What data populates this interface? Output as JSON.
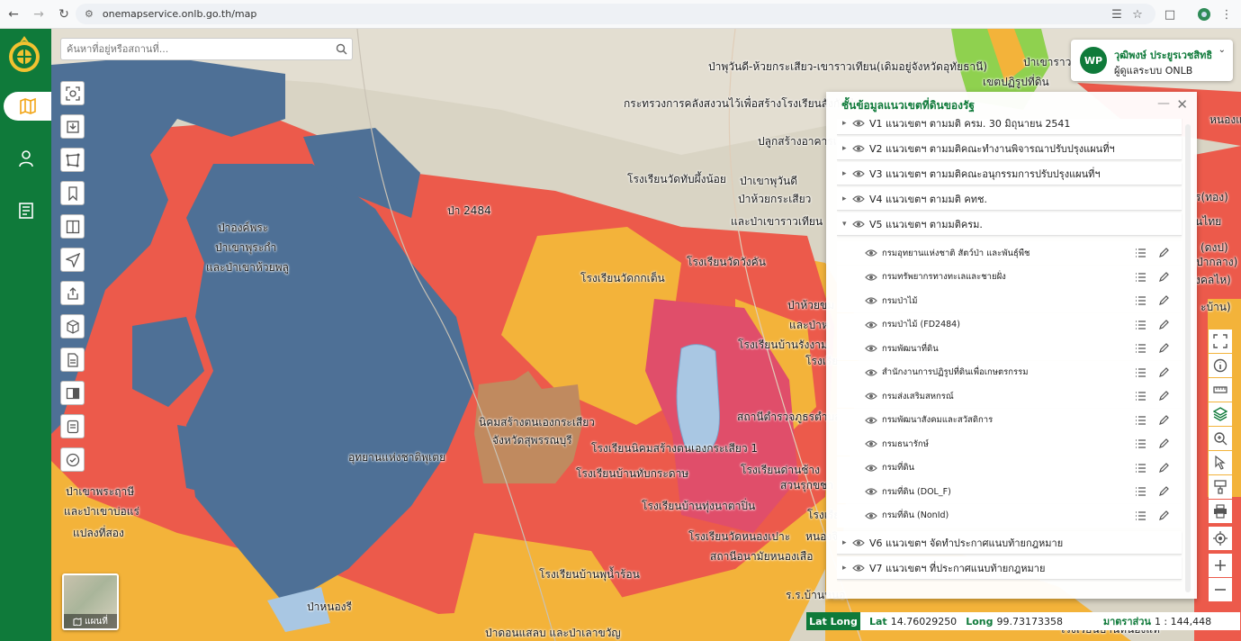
{
  "browser": {
    "url": "onemapservice.onlb.go.th/map"
  },
  "search": {
    "placeholder": "ค้นหาที่อยู่หรือสถานที่..."
  },
  "basemap": {
    "label": "แผนที่"
  },
  "user": {
    "initials": "WP",
    "name": "วุฒิพงษ์ ประยูรเวชสิทธิ",
    "role": "ผู้ดูแลระบบ ONLB"
  },
  "layer_panel": {
    "title": "ชั้นข้อมูลแนวเขตที่ดินของรัฐ",
    "groups": [
      {
        "label": "V1 แนวเขตฯ ตามมติ ครม. 30 มิถุนายน 2541",
        "expanded": false
      },
      {
        "label": "V2 แนวเขตฯ ตามมติคณะทำงานพิจารณาปรับปรุงแผนที่ฯ",
        "expanded": false
      },
      {
        "label": "V3 แนวเขตฯ ตามมติคณะอนุกรรมการปรับปรุงแผนที่ฯ",
        "expanded": false
      },
      {
        "label": "V4 แนวเขตฯ ตามมติ คทช.",
        "expanded": false
      },
      {
        "label": "V5 แนวเขตฯ ตามมติครม.",
        "expanded": true
      },
      {
        "label": "V6 แนวเขตฯ จัดทำประกาศแนบท้ายกฎหมาย",
        "expanded": false
      },
      {
        "label": "V7 แนวเขตฯ ที่ประกาศแนบท้ายกฎหมาย",
        "expanded": false
      }
    ],
    "v5_layers": [
      "กรมอุทยานแห่งชาติ สัตว์ป่า และพันธุ์พืช",
      "กรมทรัพยากรทางทะเลและชายฝั่ง",
      "กรมป่าไม้",
      "กรมป่าไม้ (FD2484)",
      "กรมพัฒนาที่ดิน",
      "สำนักงานการปฏิรูปที่ดินเพื่อเกษตรกรรม",
      "กรมส่งเสริมสหกรณ์",
      "กรมพัฒนาสังคมและสวัสดิการ",
      "กรมธนารักษ์",
      "กรมที่ดิน",
      "กรมที่ดิน (DOL_F)",
      "กรมที่ดิน (NonId)"
    ]
  },
  "coords": {
    "mode": "Lat Long",
    "lat_label": "Lat",
    "lat": "14.76029250",
    "long_label": "Long",
    "long": "99.73173358",
    "scale_label": "มาตราส่วน",
    "scale": "1 : 144,448"
  },
  "map_labels": [
    "ป่าเขาราวเทียน",
    "ป่าพุวันดี-ห้วยกระเสียว-เขาราวเทียน(เดิมอยู่จังหวัดอุทัยธานี)",
    "เขตปฏิรูปที่ดิน",
    "กระทรวงการคลังสงวนไว้เพื่อสร้างโรงเรียนสังกัดสำ",
    "ปลูกสร้างอาคารเ",
    "โรงเรียนวัดทับผึ้งน้อย",
    "ป่าเขาพุวันดี",
    "ป่าห้วยกระเสียว",
    "และป่าเขาราวเทียน",
    "ป่าองค์พระ",
    "ป่าเขาพุระกำ",
    "และป่าเขาห้วยพลู",
    "ป่า 2484",
    "โรงเรียนวัดวังคัน",
    "โรงเรียนวัดกกเต็น",
    "ป่าห้วยขม",
    "และป่าห",
    "โรงเรียนบ้านรังงาม",
    "โรงเรีย",
    "สถานีตำรวจภูธรตำบล",
    "นิคมสร้างตนเองกระเสียว",
    "จังหวัดสุพรรณบุรี",
    "โรงเรียนนิคมสร้างตนเองกระเสียว 1",
    "อุทยานแห่งชาติพุเตย",
    "โรงเรียนบ้านทับกระดาษ",
    "โรงเรียนด่านช้าง",
    "สวนรุกขชา",
    "ป่าเขาพระฤาษี",
    "และป่าเขาบ่อแร่",
    "แปลงที่สอง",
    "โรงเรียนบ้านทุ่งนาตาปิ่น",
    "โรงเรีย",
    "โรงเรียนวัดหนองเปาะ",
    "หนองจิก",
    "สถานีอนามัยหนองเสือ",
    "โรงเรียนบ้านพุน้ำร้อน",
    "ร.ร.บ้านหนอ",
    "ป่าหนองรี",
    "ป่าดอนแสลบ และป่าเลาขวัญ",
    "โรงเรียนบ้านหนองแห้",
    "หนองแจง",
    "ร(ทอง)",
    "นไทย",
    "(ดงป)",
    "ป่ากลาง)",
    "งคลไห)",
    "ะบ้าน)"
  ],
  "colors": {
    "brand_green": "#0f7a3a",
    "protected_blue": "#4e7096",
    "forest_red": "#ec5a4b",
    "reform_orange": "#f3b33a",
    "settlement_brown": "#c08a5f",
    "reservoir": "#a9c7e3"
  }
}
